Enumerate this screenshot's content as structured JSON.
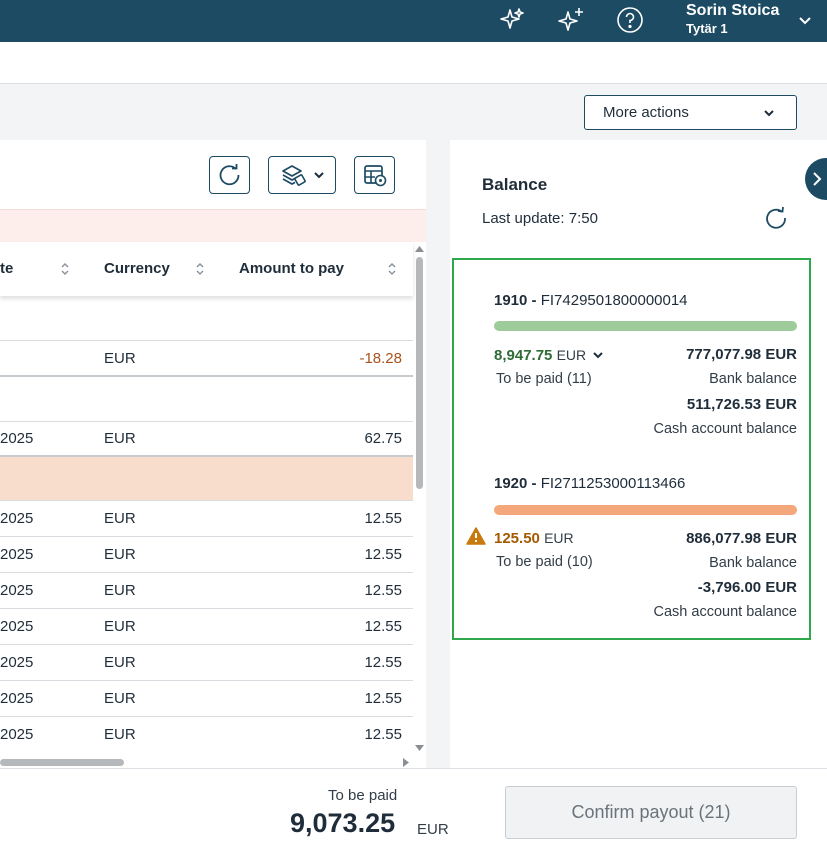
{
  "colors": {
    "topbar": "#1d4b63",
    "accent_border": "#2ea84b",
    "positive_amount": "#2e6b35",
    "warning_amount": "#a35a00",
    "negative_amount": "#a9521d",
    "bar_green": "#9dcb9a",
    "bar_orange": "#f4a77a",
    "row_highlight": "#f9ddcc"
  },
  "topbar": {
    "icons": [
      "sparkles-icon",
      "sparkles-plus-icon",
      "help-icon"
    ],
    "user_name": "Sorin Stoica",
    "user_company": "Tytär 1"
  },
  "toolbar": {
    "more_actions_label": "More actions",
    "tool_icons": [
      "refresh-icon",
      "layers-icon",
      "table-settings-icon"
    ]
  },
  "table": {
    "columns": [
      {
        "label": "te"
      },
      {
        "label": "Currency"
      },
      {
        "label": "Amount to pay"
      }
    ],
    "rows": [
      {
        "type": "group",
        "date": "",
        "currency": "",
        "amount": ""
      },
      {
        "type": "data",
        "date": "",
        "currency": "EUR",
        "amount": "-18.28",
        "negative": true
      },
      {
        "type": "group",
        "date": "",
        "currency": "",
        "amount": ""
      },
      {
        "type": "data",
        "date": "2025",
        "currency": "EUR",
        "amount": "62.75"
      },
      {
        "type": "highlight",
        "date": "",
        "currency": "",
        "amount": ""
      },
      {
        "type": "data",
        "date": "2025",
        "currency": "EUR",
        "amount": "12.55"
      },
      {
        "type": "data",
        "date": "2025",
        "currency": "EUR",
        "amount": "12.55"
      },
      {
        "type": "data",
        "date": "2025",
        "currency": "EUR",
        "amount": "12.55"
      },
      {
        "type": "data",
        "date": "2025",
        "currency": "EUR",
        "amount": "12.55"
      },
      {
        "type": "data",
        "date": "2025",
        "currency": "EUR",
        "amount": "12.55"
      },
      {
        "type": "data",
        "date": "2025",
        "currency": "EUR",
        "amount": "12.55"
      },
      {
        "type": "data",
        "date": "2025",
        "currency": "EUR",
        "amount": "12.55"
      }
    ]
  },
  "balance": {
    "title": "Balance",
    "last_update": "Last update: 7:50",
    "accounts": [
      {
        "number": "1910",
        "separator": " - ",
        "iban": "FI7429501800000014",
        "to_be_paid_amount": "8,947.75",
        "to_be_paid_currency": "EUR",
        "to_be_paid_label": "To be paid (11)",
        "bank_balance": "777,077.98 EUR",
        "bank_balance_label": "Bank balance",
        "cash_balance": "511,726.53 EUR",
        "cash_balance_label": "Cash account balance",
        "status": "ok"
      },
      {
        "number": "1920",
        "separator": " - ",
        "iban": "FI2711253000113466",
        "to_be_paid_amount": "125.50",
        "to_be_paid_currency": "EUR",
        "to_be_paid_label": "To be paid (10)",
        "bank_balance": "886,077.98 EUR",
        "bank_balance_label": "Bank balance",
        "cash_balance": "-3,796.00 EUR",
        "cash_balance_label": "Cash account balance",
        "status": "warning"
      }
    ]
  },
  "footer": {
    "to_be_paid_label": "To be paid",
    "to_be_paid_value": "9,073.25",
    "to_be_paid_currency": "EUR",
    "confirm_label": "Confirm payout (21)"
  }
}
